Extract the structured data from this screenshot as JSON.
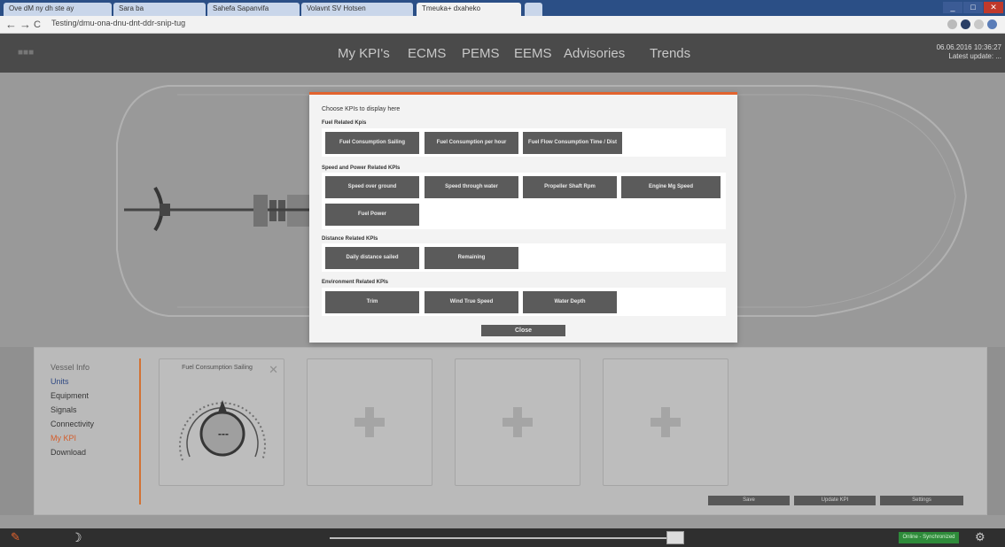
{
  "browser": {
    "tabs": [
      {
        "label": "Ove dM ny dh ste ay"
      },
      {
        "label": "Sara ba"
      },
      {
        "label": "Sahefa Sapanvifa"
      },
      {
        "label": "Volavnt SV Hotsen"
      },
      {
        "label": "Tmeuka+ dxaheko"
      }
    ],
    "url": "Testing/dmu-ona-dnu-dnt-ddr-snip-tug"
  },
  "app": {
    "nav": [
      "My KPI's",
      "ECMS",
      "PEMS",
      "EEMS",
      "Advisories",
      "Trends"
    ],
    "datetime_line1": "06.06.2016 10:36:27",
    "datetime_line2": "Latest update: ..."
  },
  "sidebar": {
    "header": "Vessel Info",
    "items": [
      {
        "label": "Units",
        "style": "blue"
      },
      {
        "label": "Equipment",
        "style": "normal"
      },
      {
        "label": "Signals",
        "style": "normal"
      },
      {
        "label": "Connectivity",
        "style": "normal"
      },
      {
        "label": "My KPI",
        "style": "active"
      },
      {
        "label": "Download",
        "style": "normal"
      }
    ]
  },
  "kpi_card": {
    "title": "Fuel Consumption Sailing",
    "gauge_value": "---"
  },
  "action_buttons": [
    "Save",
    "Update KPI",
    "Settings"
  ],
  "status": {
    "badge": "Online - Synchronized"
  },
  "modal": {
    "title": "Choose KPIs to display here",
    "sections": [
      {
        "title": "Fuel Related Kpis",
        "buttons": [
          "Fuel Consumption Sailing",
          "Fuel Consumption per hour",
          "Fuel Flow Consumption Time / Dist"
        ]
      },
      {
        "title": "Speed and Power Related KPIs",
        "buttons": [
          "Speed over ground",
          "Speed through water",
          "Propeller Shaft Rpm",
          "Engine Mg Speed",
          "Fuel Power"
        ]
      },
      {
        "title": "Distance Related KPIs",
        "buttons": [
          "Daily distance sailed",
          "Remaining"
        ]
      },
      {
        "title": "Environment Related KPIs",
        "buttons": [
          "Trim",
          "Wind True Speed",
          "Water Depth"
        ]
      }
    ],
    "close_label": "Close"
  },
  "colors": {
    "accent": "#e2632e",
    "button": "#5b5b5b",
    "status_green": "#2e8b3a"
  }
}
